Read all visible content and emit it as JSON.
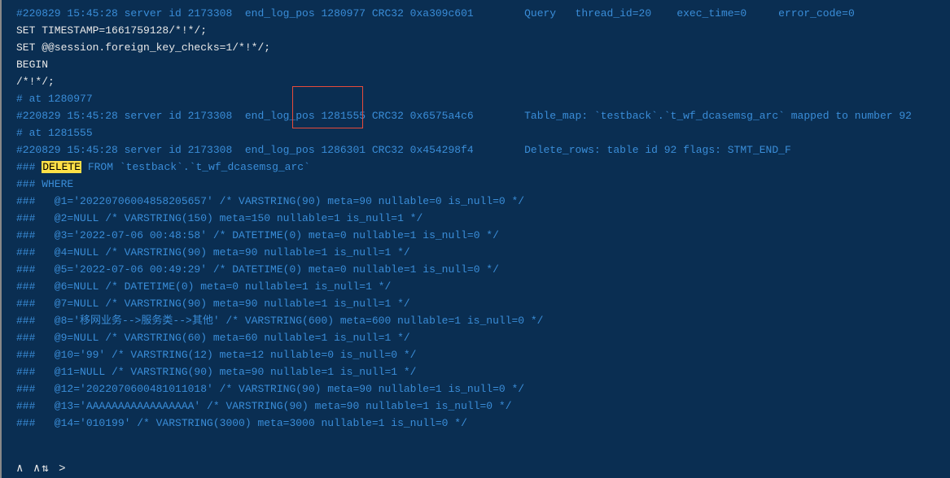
{
  "lines": {
    "l0": "#220829 15:45:28 server id 2173308  end_log_pos 1280977 CRC32 0xa309c601        Query   thread_id=20    exec_time=0     error_code=0",
    "l1": "SET TIMESTAMP=1661759128/*!*/;",
    "l2": "SET @@session.foreign_key_checks=1/*!*/;",
    "l3": "BEGIN",
    "l4": "/*!*/;",
    "l5": "# at 1280977",
    "l6": "#220829 15:45:28 server id 2173308  end_log_pos 1281555 CRC32 0x6575a4c6        Table_map: `testback`.`t_wf_dcasemsg_arc` mapped to number 92",
    "l7": "# at 1281555",
    "l8": "#220829 15:45:28 server id 2173308  end_log_pos 1286301 CRC32 0x454298f4        Delete_rows: table id 92 flags: STMT_END_F",
    "l9a": "### ",
    "l9b": "DELETE",
    "l9c": " FROM `testback`.`t_wf_dcasemsg_arc`",
    "l10": "### WHERE",
    "l11": "###   @1='20220706004858205657' /* VARSTRING(90) meta=90 nullable=0 is_null=0 */",
    "l12": "###   @2=NULL /* VARSTRING(150) meta=150 nullable=1 is_null=1 */",
    "l13": "###   @3='2022-07-06 00:48:58' /* DATETIME(0) meta=0 nullable=1 is_null=0 */",
    "l14": "###   @4=NULL /* VARSTRING(90) meta=90 nullable=1 is_null=1 */",
    "l15": "###   @5='2022-07-06 00:49:29' /* DATETIME(0) meta=0 nullable=1 is_null=0 */",
    "l16": "###   @6=NULL /* DATETIME(0) meta=0 nullable=1 is_null=1 */",
    "l17": "###   @7=NULL /* VARSTRING(90) meta=90 nullable=1 is_null=1 */",
    "l18": "###   @8='移网业务-->服务类-->其他' /* VARSTRING(600) meta=600 nullable=1 is_null=0 */",
    "l19": "###   @9=NULL /* VARSTRING(60) meta=60 nullable=1 is_null=1 */",
    "l20": "###   @10='99' /* VARSTRING(12) meta=12 nullable=0 is_null=0 */",
    "l21": "###   @11=NULL /* VARSTRING(90) meta=90 nullable=1 is_null=1 */",
    "l22": "###   @12='2022070600481011018' /* VARSTRING(90) meta=90 nullable=1 is_null=0 */",
    "l23": "###   @13='AAAAAAAAAAAAAAAAA' /* VARSTRING(90) meta=90 nullable=1 is_null=0 */",
    "l24": "###   @14='010199' /* VARSTRING(3000) meta=3000 nullable=1 is_null=0 */"
  },
  "redbox": {
    "top": "106",
    "left": "357",
    "width": "87",
    "height": "52"
  },
  "bottom_icons": "∧ ∧⇅ >"
}
